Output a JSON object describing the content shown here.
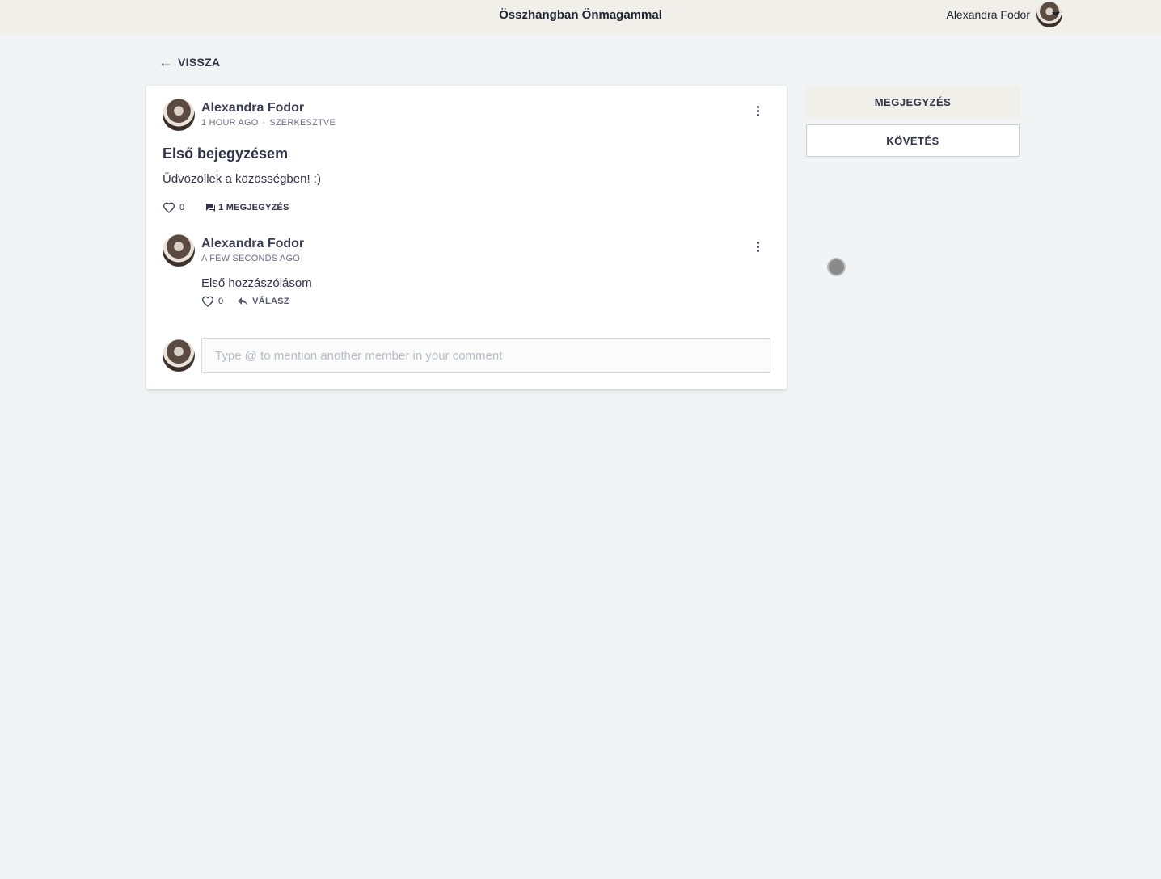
{
  "header": {
    "site_title": "Összhangban Önmagammal",
    "user_name": "Alexandra Fodor"
  },
  "back": {
    "label": "VISSZA"
  },
  "post": {
    "author": "Alexandra Fodor",
    "time": "1 HOUR AGO",
    "edited": "SZERKESZTVE",
    "title": "Első bejegyzésem",
    "body": "Üdvözöllek a közösségben! :)",
    "likes": "0",
    "comments_label": "1 MEGJEGYZÉS"
  },
  "comment": {
    "author": "Alexandra Fodor",
    "time": "A FEW SECONDS AGO",
    "text": "Első hozzászólásom",
    "likes": "0",
    "reply_label": "VÁLASZ"
  },
  "composer": {
    "placeholder": "Type @ to mention another member in your comment"
  },
  "sidebar": {
    "comment_button": "MEGJEGYZÉS",
    "follow_button": "KÖVETÉS"
  }
}
